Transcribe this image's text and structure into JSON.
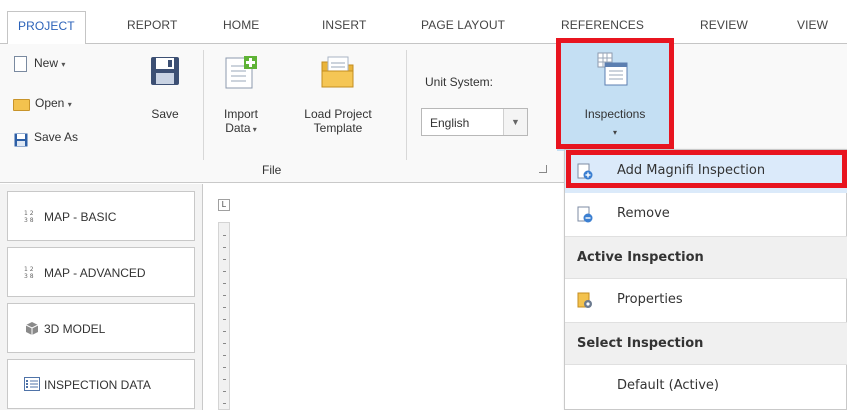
{
  "ribbon_tabs": [
    {
      "label": "PROJECT"
    },
    {
      "label": "REPORT"
    },
    {
      "label": "HOME"
    },
    {
      "label": "INSERT"
    },
    {
      "label": "PAGE LAYOUT"
    },
    {
      "label": "REFERENCES"
    },
    {
      "label": "REVIEW"
    },
    {
      "label": "VIEW"
    }
  ],
  "ribbon": {
    "new_label": "New",
    "open_label": "Open",
    "save_as_label": "Save As",
    "save_label": "Save",
    "import_label_1": "Import",
    "import_label_2": "Data",
    "load_template_label_1": "Load Project",
    "load_template_label_2": "Template",
    "unit_system_label": "Unit System:",
    "unit_system_value": "English",
    "inspections_label": "Inspections",
    "file_group_label": "File"
  },
  "left_panel": {
    "buttons": [
      {
        "label": "MAP - BASIC"
      },
      {
        "label": "MAP - ADVANCED"
      },
      {
        "label": "3D MODEL"
      },
      {
        "label": "INSPECTION DATA"
      }
    ]
  },
  "ruler_corner": "L",
  "inspections_menu": {
    "add_label": "Add Magnifi Inspection",
    "remove_label": "Remove",
    "active_header": "Active Inspection",
    "properties_label": "Properties",
    "select_header": "Select Inspection",
    "default_label": "Default (Active)"
  },
  "colors": {
    "active_tab_text": "#2b62b9",
    "highlight_box": "#e8141f",
    "selected_button_bg": "#c4dff3"
  }
}
